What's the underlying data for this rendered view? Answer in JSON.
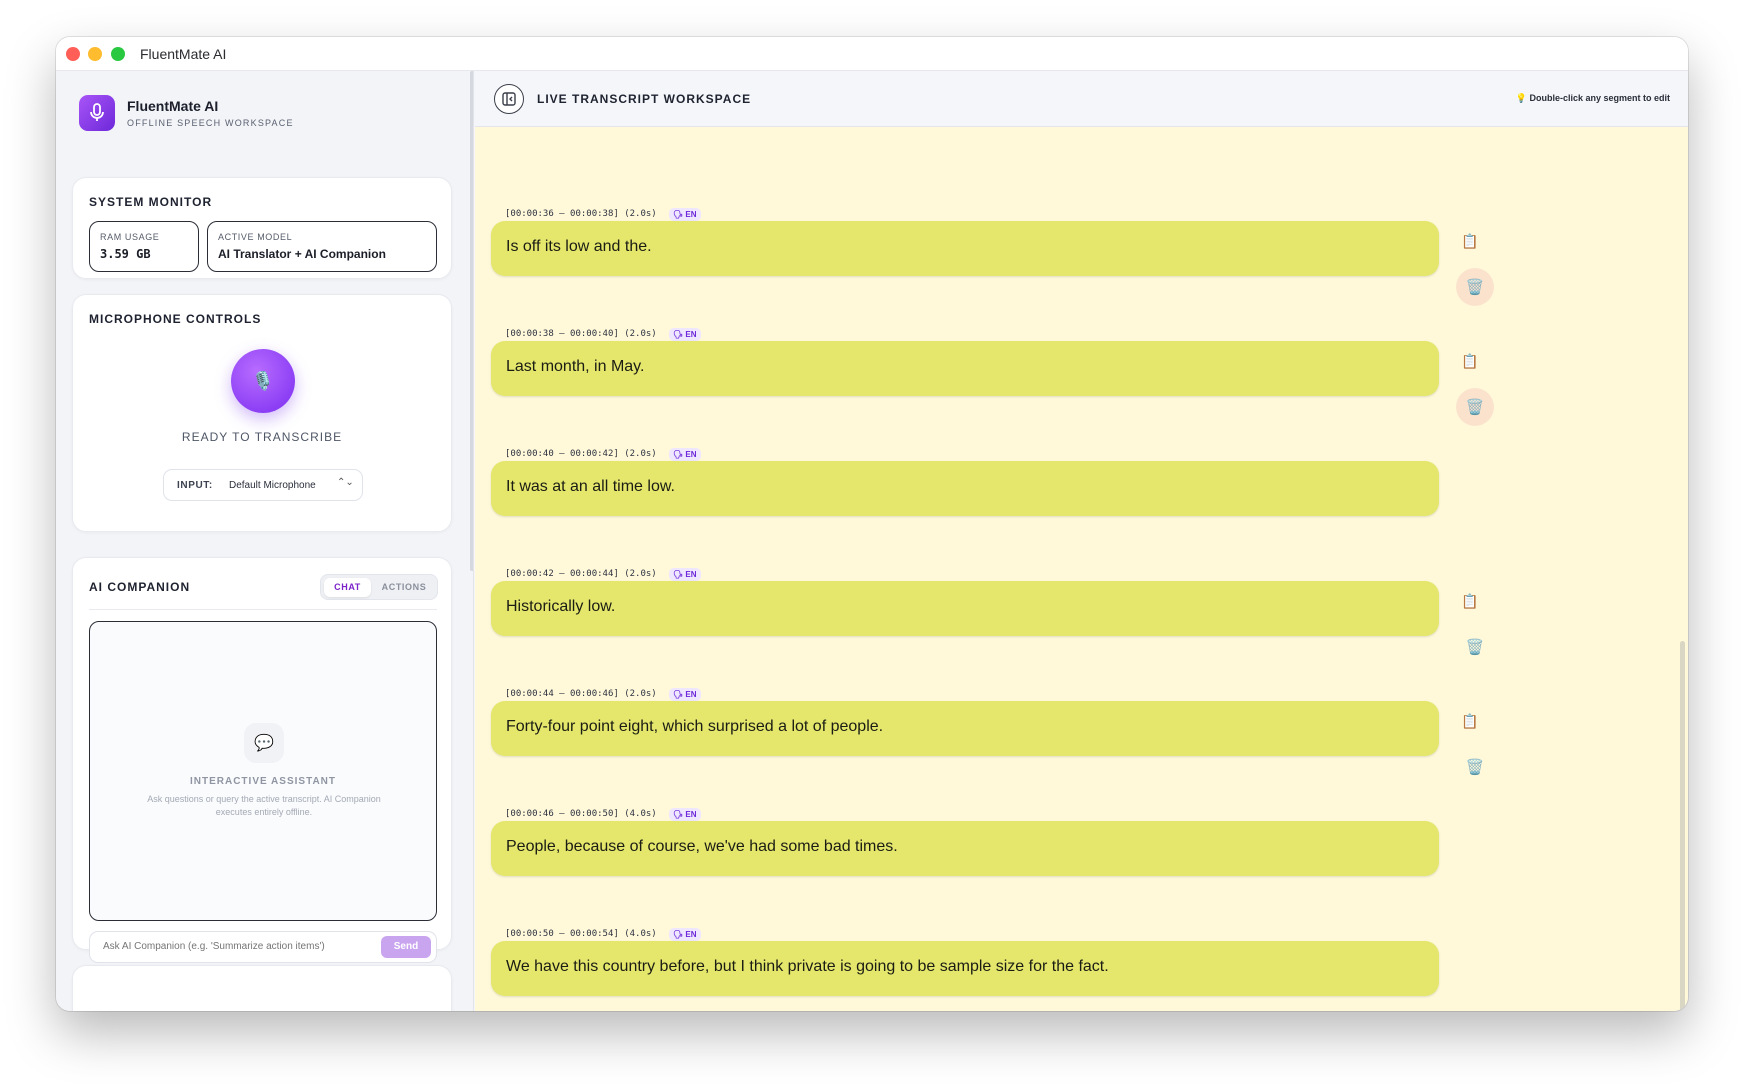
{
  "window": {
    "title": "FluentMate AI"
  },
  "brand": {
    "name": "FluentMate AI",
    "subtitle": "OFFLINE SPEECH WORKSPACE",
    "icon": "microphone-icon"
  },
  "system_monitor": {
    "title": "SYSTEM MONITOR",
    "ram_label": "RAM USAGE",
    "ram_value": "3.59 GB",
    "model_label": "ACTIVE MODEL",
    "model_value": "AI Translator + AI Companion"
  },
  "microphone": {
    "title": "MICROPHONE CONTROLS",
    "button_icon": "🎙️",
    "status": "READY TO TRANSCRIBE",
    "input_label": "INPUT:",
    "input_value": "Default Microphone"
  },
  "ai_companion": {
    "title": "AI COMPANION",
    "tabs": [
      {
        "label": "CHAT",
        "active": true
      },
      {
        "label": "ACTIONS",
        "active": false
      }
    ],
    "empty_icon": "💬",
    "empty_title": "INTERACTIVE ASSISTANT",
    "empty_desc": "Ask questions or query the active transcript. AI Companion executes entirely offline.",
    "input_placeholder": "Ask AI Companion (e.g. 'Summarize action items')",
    "send_label": "Send"
  },
  "workspace": {
    "title": "LIVE TRANSCRIPT WORKSPACE",
    "hint": "💡 Double-click any segment to edit"
  },
  "segments": [
    {
      "time": "[00:00:36 – 00:00:38] (2.0s)",
      "lang": "🗣 EN",
      "text": "Is off its low and the.",
      "copy_icon": "📋",
      "delete_icon": "🗑️",
      "show_actions": true,
      "delete_highlight": true
    },
    {
      "time": "[00:00:38 – 00:00:40] (2.0s)",
      "lang": "🗣 EN",
      "text": "Last month, in May.",
      "copy_icon": "📋",
      "delete_icon": "🗑️",
      "show_actions": true,
      "delete_highlight": true
    },
    {
      "time": "[00:00:40 – 00:00:42] (2.0s)",
      "lang": "🗣 EN",
      "text": "It was at an all time low.",
      "copy_icon": "📋",
      "delete_icon": "🗑️",
      "show_actions": false,
      "delete_highlight": false
    },
    {
      "time": "[00:00:42 – 00:00:44] (2.0s)",
      "lang": "🗣 EN",
      "text": "Historically low.",
      "copy_icon": "📋",
      "delete_icon": "🗑️",
      "show_actions": true,
      "delete_highlight": false
    },
    {
      "time": "[00:00:44 – 00:00:46] (2.0s)",
      "lang": "🗣 EN",
      "text": "Forty-four point eight, which surprised a lot of people.",
      "copy_icon": "📋",
      "delete_icon": "🗑️",
      "show_actions": true,
      "delete_highlight": false
    },
    {
      "time": "[00:00:46 – 00:00:50] (4.0s)",
      "lang": "🗣 EN",
      "text": "People, because of course, we've had some bad times.",
      "copy_icon": "📋",
      "delete_icon": "🗑️",
      "show_actions": false,
      "delete_highlight": false
    },
    {
      "time": "[00:00:50 – 00:00:54] (4.0s)",
      "lang": "🗣 EN",
      "text": "We have this country before, but I think private is going to be sample size for the fact.",
      "copy_icon": "📋",
      "delete_icon": "🗑️",
      "show_actions": false,
      "delete_highlight": false
    }
  ],
  "colors": {
    "accent": "#7c3aed",
    "bubble": "#e4e76c",
    "workspace_bg": "#fff9da",
    "delete_highlight": "#fbe2cc"
  }
}
